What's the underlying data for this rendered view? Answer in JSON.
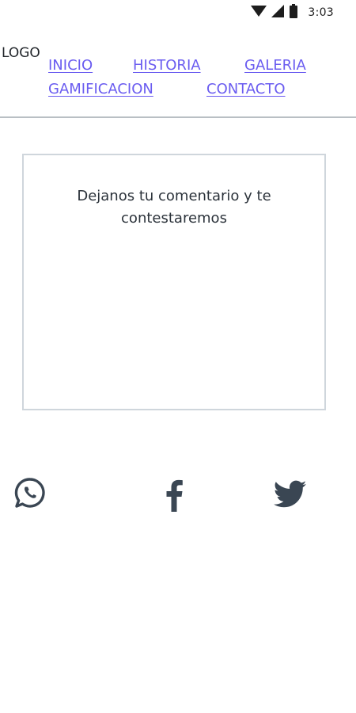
{
  "status_bar": {
    "time": "3:03",
    "icons": [
      "wifi-icon",
      "signal-icon",
      "battery-icon"
    ]
  },
  "header": {
    "logo": "LOGO",
    "nav": {
      "inicio": "INICIO",
      "historia": "HISTORIA",
      "galeria": "GALERIA",
      "gamificacion": "GAMIFICACION",
      "contacto": "CONTACTO"
    }
  },
  "comment_box": {
    "prompt": "Dejanos tu comentario y te contestaremos"
  },
  "social": {
    "icons": [
      "whatsapp-icon",
      "facebook-icon",
      "twitter-icon"
    ]
  },
  "colors": {
    "link": "#6a5cf0",
    "text": "#2b323a",
    "divider": "#b9bfc4",
    "box_border": "#cfd6dc",
    "icon": "#3a4653"
  }
}
